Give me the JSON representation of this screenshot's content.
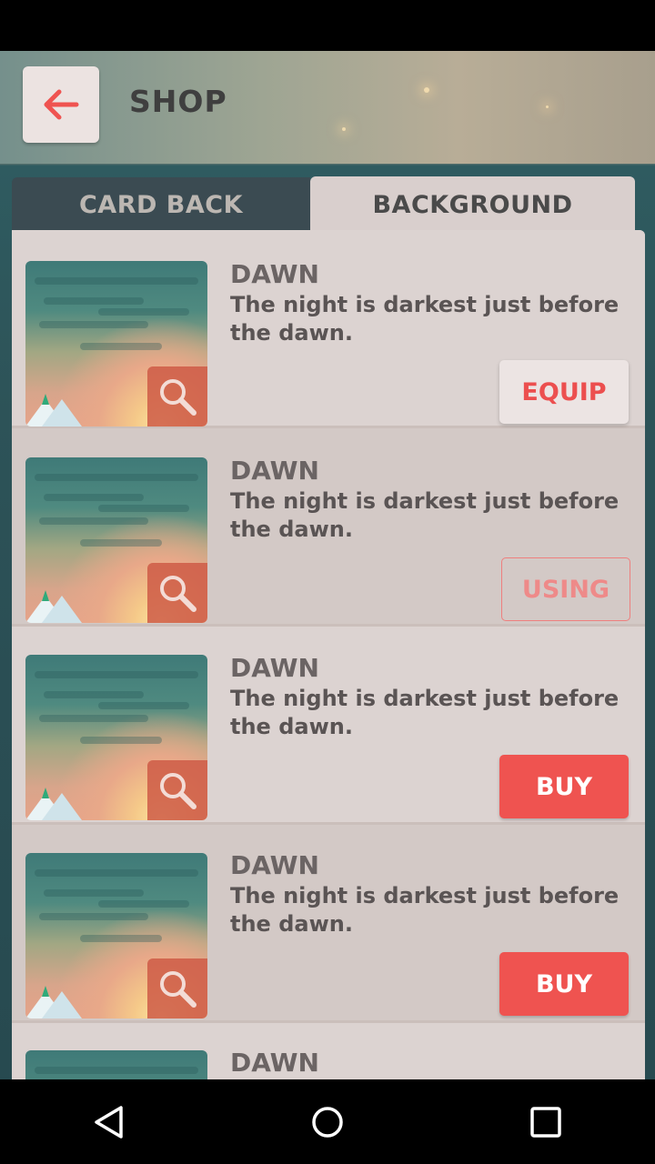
{
  "header": {
    "title": "SHOP",
    "back_icon": "arrow-left-icon"
  },
  "tabs": [
    {
      "label": "CARD BACK",
      "selected": false
    },
    {
      "label": "BACKGROUND",
      "selected": true
    }
  ],
  "items": [
    {
      "name": "DAWN",
      "description": "The night is darkest just before the dawn.",
      "button": "EQUIP"
    },
    {
      "name": "DAWN",
      "description": "The night is darkest just before the dawn.",
      "button": "USING"
    },
    {
      "name": "DAWN",
      "description": "The night is darkest just before the dawn.",
      "button": "BUY"
    },
    {
      "name": "DAWN",
      "description": "The night is darkest just before the dawn.",
      "button": "BUY"
    },
    {
      "name": "DAWN"
    }
  ],
  "navigation": {
    "back_icon": "triangle-back-icon",
    "home_icon": "circle-home-icon",
    "recents_icon": "square-recents-icon"
  },
  "colors": {
    "accent": "#ef5350",
    "title": "#3f3f3f",
    "tab_inactive": "#3b4b52"
  }
}
